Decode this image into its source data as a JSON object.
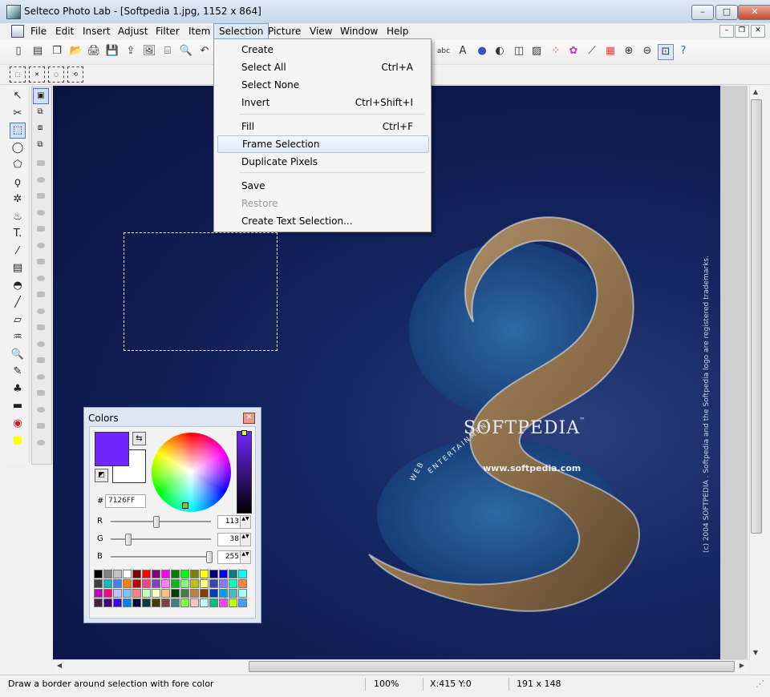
{
  "window": {
    "title": "Selteco Photo Lab - [Softpedia 1.jpg, 1152 x 864]",
    "controls": {
      "minimize": "–",
      "maximize": "□",
      "close": "✕"
    }
  },
  "menubar": {
    "items": [
      "File",
      "Edit",
      "Insert",
      "Adjust",
      "Filter",
      "Item",
      "Selection",
      "Picture",
      "View",
      "Window",
      "Help"
    ],
    "active": "Selection",
    "mdi_controls": {
      "minimize": "–",
      "restore": "❐",
      "close": "✕"
    }
  },
  "toolbar": {
    "items": [
      "new-icon",
      "open-icon",
      "copy-icon",
      "folder-icon",
      "print-icon",
      "save-icon",
      "export-icon",
      "image-icon",
      "scanner-icon",
      "preview-icon",
      "undo-icon",
      "text-abc-icon",
      "text-a-icon",
      "circle-blue-icon",
      "contrast-icon",
      "frame-icon",
      "picture-icon",
      "rgb-icon",
      "color-wheel-icon",
      "brush-icon",
      "palette-icon",
      "zoom-in-icon",
      "zoom-out-icon",
      "zoom-fit-icon",
      "help-icon"
    ],
    "glyphs": {
      "abc": "abc",
      "a": "A",
      "undo": "↶"
    }
  },
  "selection_toolbar": {
    "items": [
      "rect-select-icon",
      "remove-select-icon",
      "magic-select-icon",
      "lasso-select-icon"
    ]
  },
  "dropdown": {
    "menu": "Selection",
    "items": [
      {
        "label": "Create",
        "shortcut": "",
        "state": "normal"
      },
      {
        "label": "Select All",
        "shortcut": "Ctrl+A",
        "state": "normal"
      },
      {
        "label": "Select None",
        "shortcut": "",
        "state": "normal"
      },
      {
        "label": "Invert",
        "shortcut": "Ctrl+Shift+I",
        "state": "normal"
      },
      {
        "label": "Fill",
        "shortcut": "Ctrl+F",
        "state": "normal"
      },
      {
        "label": "Frame Selection",
        "shortcut": "",
        "state": "highlighted"
      },
      {
        "label": "Duplicate Pixels",
        "shortcut": "",
        "state": "normal"
      },
      {
        "label": "Save",
        "shortcut": "",
        "state": "normal"
      },
      {
        "label": "Restore",
        "shortcut": "",
        "state": "disabled"
      },
      {
        "label": "Create Text Selection...",
        "shortcut": "",
        "state": "normal"
      }
    ]
  },
  "tools": [
    "pointer",
    "scissors",
    "rect-select",
    "ellipse-select",
    "polygon-select",
    "lasso",
    "magic-wand",
    "clone",
    "text",
    "eyedropper",
    "gradient",
    "hue",
    "line",
    "eraser",
    "fill",
    "zoom",
    "pencil",
    "stamp",
    "ruler",
    "red-eye",
    "color"
  ],
  "tool_glyphs": [
    "↖",
    "✂",
    "⬚",
    "◯",
    "⬠",
    "ϙ",
    "✲",
    "♨",
    "T.",
    "⁄",
    "▤",
    "◓",
    "╱",
    "▱",
    "♒",
    "🔍",
    "✎",
    "♣",
    "▬",
    "◉",
    "■"
  ],
  "canvas": {
    "watermark": {
      "title": "SOFTPEDIA",
      "tm": "™",
      "url": "www.softpedia.com",
      "arc_web": "WEB",
      "arc_ent": "ENTERTAINMENT",
      "vertical": "(c) 2004  SOFTPEDIA .  Softpedia and the Softpedia logo are registered trademarks."
    }
  },
  "colors_panel": {
    "title": "Colors",
    "close": "✕",
    "fore_color": "#7126FF",
    "back_color": "#FFFFFF",
    "hex_label": "#",
    "hex": "7126FF",
    "channels": [
      {
        "label": "R",
        "value": "113",
        "fraction": 0.443
      },
      {
        "label": "G",
        "value": "38",
        "fraction": 0.149
      },
      {
        "label": "B",
        "value": "255",
        "fraction": 1.0
      }
    ],
    "palette": [
      "#000000",
      "#808080",
      "#c0c0c0",
      "#ffffff",
      "#800000",
      "#ff0000",
      "#800080",
      "#ff00ff",
      "#008000",
      "#00ff00",
      "#808000",
      "#ffff00",
      "#000080",
      "#0000ff",
      "#008080",
      "#00ffff",
      "#404040",
      "#00c0c0",
      "#4080ff",
      "#ff8000",
      "#c00000",
      "#ff4080",
      "#8040c0",
      "#ff80ff",
      "#00c000",
      "#80ff80",
      "#c0c000",
      "#ffff80",
      "#4040c0",
      "#8080ff",
      "#00ffc0",
      "#ff8040",
      "#c000c0",
      "#ff0080",
      "#c0c0ff",
      "#80c0ff",
      "#ff8080",
      "#c0ffc0",
      "#ffffc0",
      "#ffc080",
      "#004000",
      "#408040",
      "#c08040",
      "#804000",
      "#0040c0",
      "#00a0ff",
      "#40c0c0",
      "#a0ffff",
      "#402040",
      "#400080",
      "#4000ff",
      "#0080ff",
      "#000040",
      "#004040",
      "#404000",
      "#804040",
      "#408080",
      "#80ff40",
      "#ffc0c0",
      "#c0ffff",
      "#00c080",
      "#ff40ff",
      "#c0ff00",
      "#40a0ff"
    ],
    "icons": {
      "swap": "⇆",
      "default": "◩",
      "spin": "▲▼"
    }
  },
  "status": {
    "hint": "Draw a border around selection with fore color",
    "zoom": "100%",
    "coords": "X:415  Y:0",
    "size": "191 x 148",
    "grip": "⋰"
  }
}
